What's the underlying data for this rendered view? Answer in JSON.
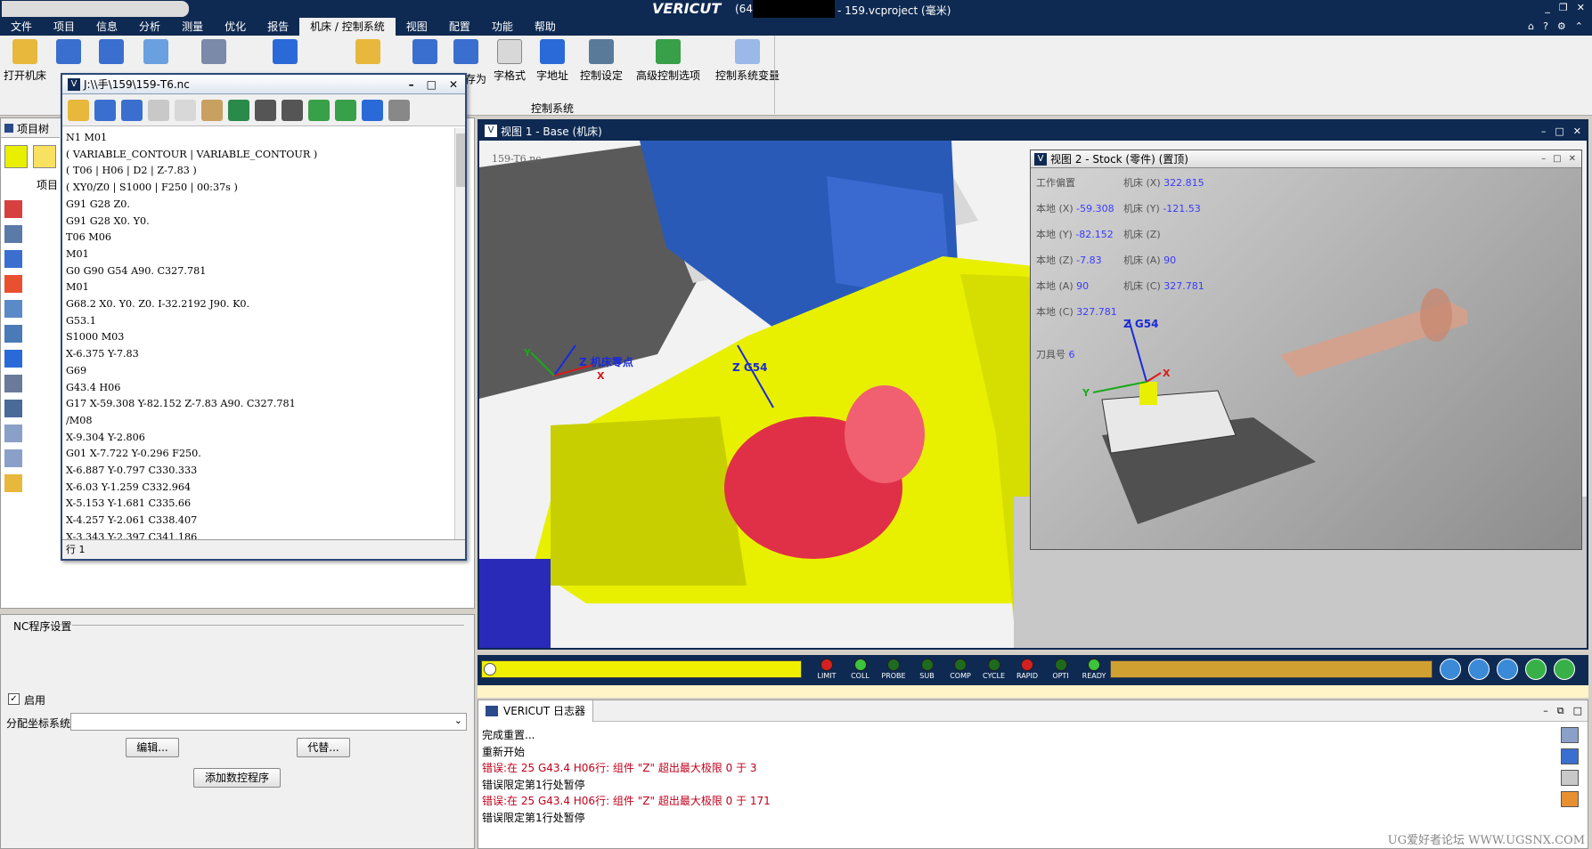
{
  "title_bar": {
    "brand": "VERICUT",
    "version_fragment": "(64",
    "project": "- 159.vcproject (毫米)"
  },
  "menu": [
    "文件",
    "项目",
    "信息",
    "分析",
    "测量",
    "优化",
    "报告",
    "机床 / 控制系统",
    "视图",
    "配置",
    "功能",
    "帮助"
  ],
  "ribbon": {
    "buttons": [
      "打开机床",
      "字格式",
      "字地址",
      "控制设定",
      "高级控制选项",
      "控制系统变量"
    ],
    "group_label": "控制系统",
    "partial_label": "另存为"
  },
  "left_pane": {
    "tab_label": "项目树",
    "tree_root": "项目"
  },
  "nc_editor": {
    "title": "J:\\\\手\\159\\159-T6.nc",
    "lines": [
      "N1 M01",
      "( VARIABLE_CONTOUR | VARIABLE_CONTOUR )",
      "( T06 | H06 | D2 | Z-7.83 )",
      "( XY0/Z0 | S1000 | F250 | 00:37s )",
      "G91 G28 Z0.",
      "G91 G28 X0. Y0.",
      "T06 M06",
      "M01",
      "G0 G90 G54 A90. C327.781",
      "M01",
      "G68.2 X0. Y0. Z0. I-32.2192 J90. K0.",
      "G53.1",
      "S1000 M03",
      "X-6.375 Y-7.83",
      "G69",
      "G43.4 H06",
      "G17 X-59.308 Y-82.152 Z-7.83 A90. C327.781",
      "/M08",
      "X-9.304 Y-2.806",
      "G01 X-7.722 Y-0.296 F250.",
      "X-6.887 Y-0.797 C330.333",
      "X-6.03 Y-1.259 C332.964",
      "X-5.153 Y-1.681 C335.66",
      "X-4.257 Y-2.061 C338.407",
      "X-3.343 Y-2.397 C341.186"
    ],
    "status": "行 1"
  },
  "nc_settings": {
    "title": "NC程序设置",
    "enable_label": "启用",
    "coord_label": "分配坐标系统",
    "edit_button": "编辑...",
    "replace_button": "代替...",
    "add_button": "添加数控程序"
  },
  "view1": {
    "title": "视图 1 - Base (机床)",
    "file_overlay": "159-T6.nc",
    "label_zero": "Z 机床零点",
    "label_g54": "Z G54",
    "axis_x": "X",
    "axis_y": "Y"
  },
  "view2": {
    "title": "视图 2 - Stock (零件) (置顶)",
    "offset_label": "工作偏置",
    "fields": [
      {
        "label": "机床 (X)",
        "value": "322.815"
      },
      {
        "label": "本地 (X)",
        "value": "-59.308"
      },
      {
        "label": "机床 (Y)",
        "value": "-121.53"
      },
      {
        "label": "本地 (Y)",
        "value": "-82.152"
      },
      {
        "label": "机床 (Z)",
        "value": ""
      },
      {
        "label": "本地 (Z)",
        "value": "-7.83"
      },
      {
        "label": "机床 (A)",
        "value": "90"
      },
      {
        "label": "本地 (A)",
        "value": "90"
      },
      {
        "label": "机床 (C)",
        "value": "327.781"
      },
      {
        "label": "本地 (C)",
        "value": "327.781"
      }
    ],
    "tool_label": "刀具号",
    "tool_value": "6",
    "label_g54": "Z G54",
    "axis_x": "X",
    "axis_y": "Y"
  },
  "sim_bar": {
    "leds": [
      {
        "label": "LIMIT",
        "color": "#d42020"
      },
      {
        "label": "COLL",
        "color": "#3cc43c"
      },
      {
        "label": "PROBE",
        "color": "#1e6a1e"
      },
      {
        "label": "SUB",
        "color": "#1e6a1e"
      },
      {
        "label": "COMP",
        "color": "#1e6a1e"
      },
      {
        "label": "CYCLE",
        "color": "#1e6a1e"
      },
      {
        "label": "RAPID",
        "color": "#d42020"
      },
      {
        "label": "OPTI",
        "color": "#1e6a1e"
      },
      {
        "label": "READY",
        "color": "#3cc43c"
      }
    ]
  },
  "log": {
    "title": "VERICUT 日志器",
    "lines": [
      {
        "text": "完成重置...",
        "type": "info"
      },
      {
        "text": "重新开始",
        "type": "info"
      },
      {
        "text": "错误:在 25 G43.4 H06行: 组件 \"Z\" 超出最大极限 0 于 3",
        "type": "error"
      },
      {
        "text": "错误限定第1行处暂停",
        "type": "info"
      },
      {
        "text": "错误:在 25 G43.4 H06行: 组件 \"Z\" 超出最大极限 0 于 171",
        "type": "error"
      },
      {
        "text": "错误限定第1行处暂停",
        "type": "info"
      }
    ]
  },
  "watermark": "UG爱好者论坛 WWW.UGSNX.COM",
  "colors": {
    "accent": "#0e2a52",
    "machine_yellow": "#e8f000",
    "part_red": "#e03048",
    "machine_blue": "#2a5ab8"
  }
}
